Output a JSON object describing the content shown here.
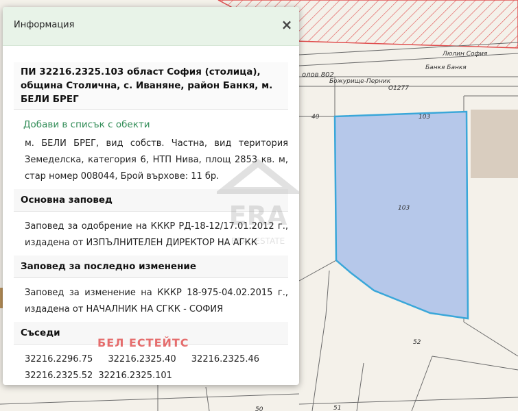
{
  "panel": {
    "title": "Информация",
    "close_symbol": "×",
    "property_heading": "ПИ 32216.2325.103 област София (столица), община Столична, с. Иваняне, район Банкя, м. БЕЛИ БРЕГ",
    "add_link": "Добави в списък с обекти",
    "description": "м. БЕЛИ БРЕГ, вид собств. Частна, вид територия Земеделска, категория 6, НТП Нива, площ 2853 кв. м, стар номер 008044, Брой върхове: 11 бр.",
    "main_order_heading": "Основна заповед",
    "main_order_text": "Заповед за одобрение на КККР РД-18-12/17.01.2012 г., издадена от ИЗПЪЛНИТЕЛЕН ДИРЕКТОР НА АГКК",
    "last_change_heading": "Заповед за последно изменение",
    "last_change_text": "Заповед за изменение на КККР 18-975-04.02.2015 г., издадена от НАЧАЛНИК НА СГКК - СОФИЯ",
    "neighbors_heading": "Съседи",
    "neighbors": [
      "32216.2296.75",
      "32216.2325.40",
      "32216.2325.46",
      "32216.2325.52",
      "32216.2325.101"
    ]
  },
  "watermark": "БЕЛ ЕСТЕЙТС",
  "era_logo": {
    "line1": "ERA",
    "line2": "REAL ESTATE"
  },
  "map": {
    "labels": {
      "street_top": "Люлин  София",
      "street_top2": "Банкя   Банкя",
      "road_name": "олов  802",
      "road_sub": "Божурище-Перник",
      "point": "О1277",
      "n40": "40",
      "n103_top": "103",
      "n103_center": "103",
      "n52": "52",
      "n51": "51",
      "n50": "50"
    },
    "colors": {
      "parcel_fill": "#b6c8ea",
      "parcel_stroke": "#3aa7d9",
      "hatch": "#e05050",
      "building": "#d9cdbf",
      "lines": "#6b6b6b"
    }
  }
}
